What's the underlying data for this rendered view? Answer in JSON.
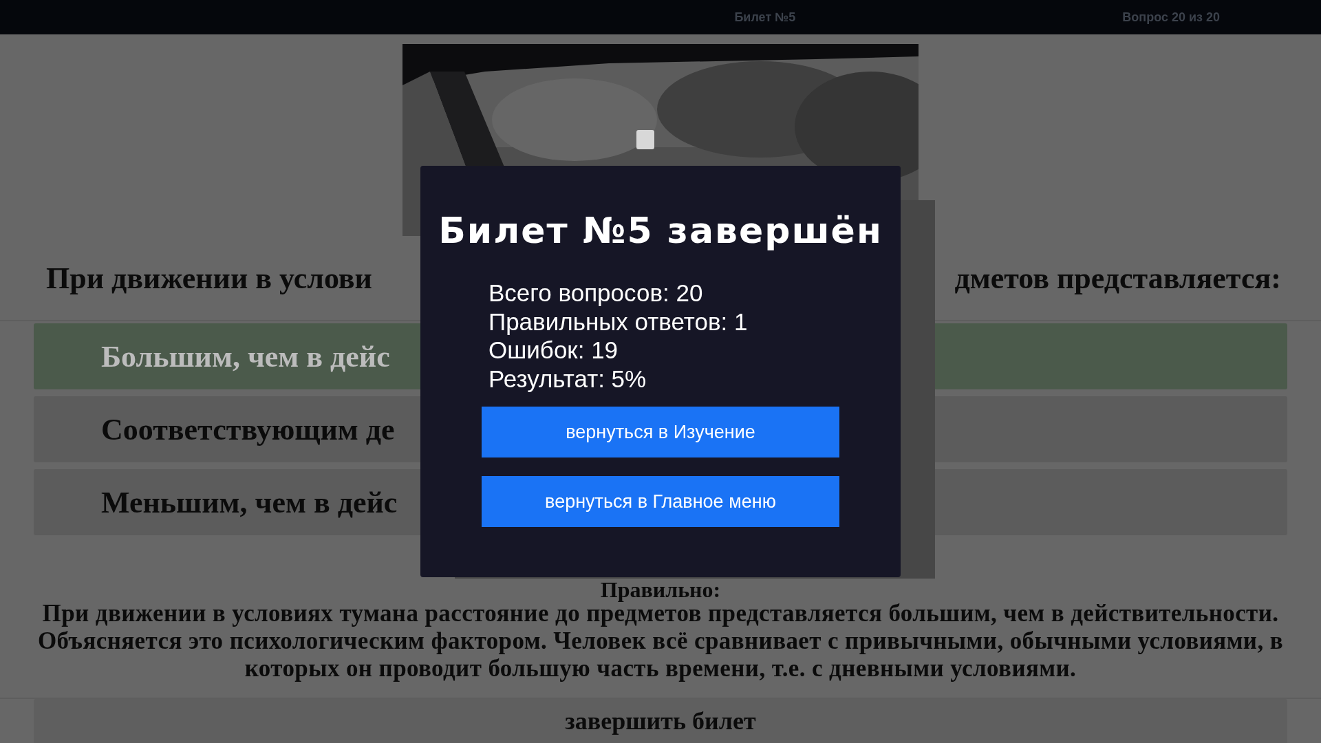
{
  "top_bar": {
    "ticket": "Билет №5",
    "progress": "Вопрос 20 из 20"
  },
  "question": {
    "left_part": "При движении в услови",
    "right_part": "дметов представляется:"
  },
  "answers": [
    {
      "text": "Большим, чем в дейс",
      "correct": true
    },
    {
      "text": "Соответствующим де",
      "correct": false
    },
    {
      "text": "Меньшим, чем в дейс",
      "correct": false
    }
  ],
  "explanation": {
    "heading": "Правильно:",
    "text": "При движении в условиях тумана расстояние до предметов представляется большим, чем в действительности. Объясняется это психологическим фактором. Человек всё сравнивает с привычными, обычными условиями, в которых он проводит большую часть времени, т.е. с дневными условиями."
  },
  "finish_button": "завершить билет",
  "dialog": {
    "title": "Билет №5 завершён",
    "stats": [
      "Всего вопросов: 20",
      "Правильных ответов: 1",
      "Ошибок: 19",
      "Результат: 5%"
    ],
    "buttons": [
      "вернуться в Изучение",
      "вернуться в Главное меню"
    ]
  }
}
